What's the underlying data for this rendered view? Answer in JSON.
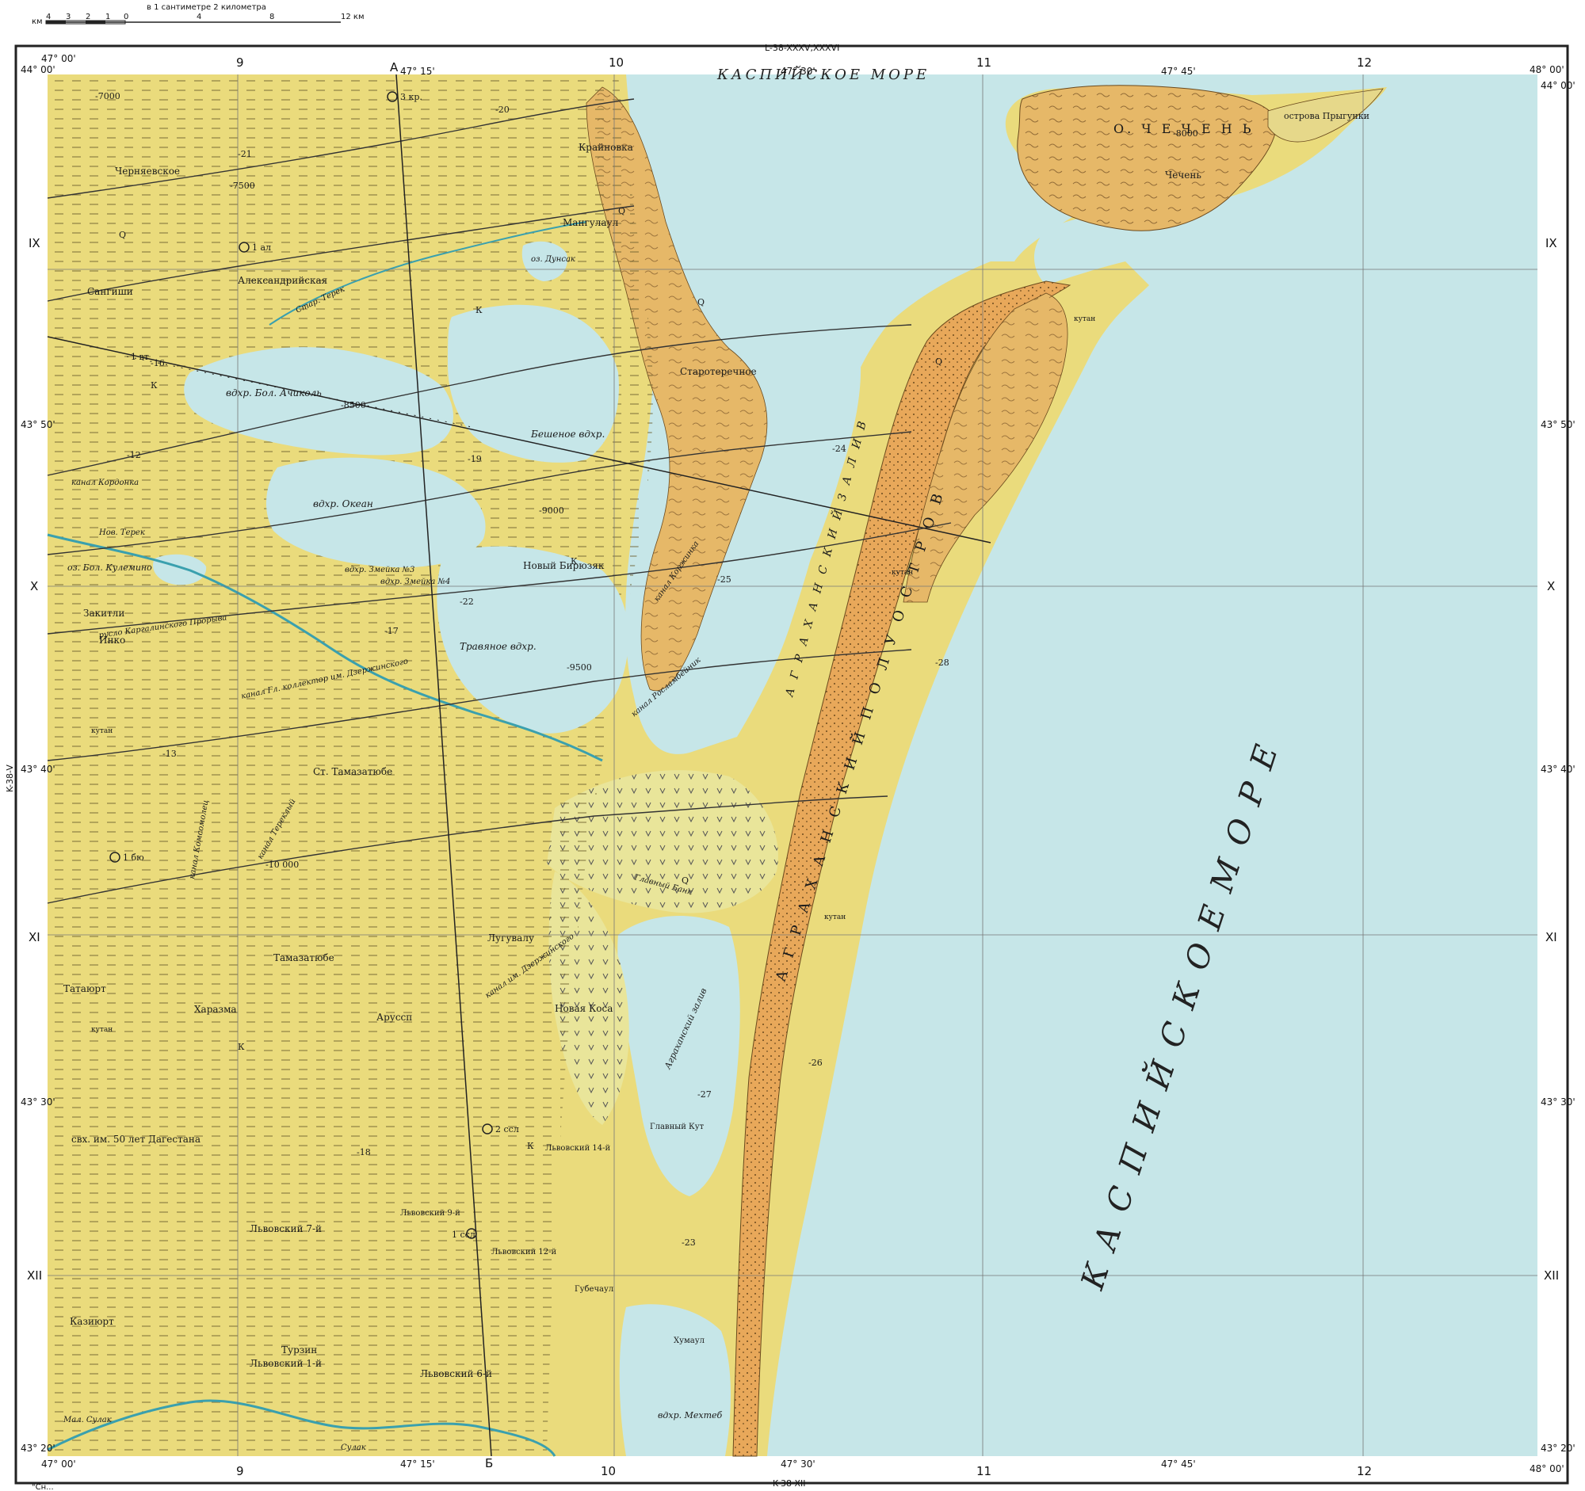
{
  "scale": {
    "caption": "в 1 сантиметре 2 километра",
    "unit_left": "км",
    "unit_right": "12 км",
    "ticks": [
      "4",
      "3",
      "2",
      "1",
      "0",
      "4",
      "8"
    ]
  },
  "sheet": {
    "top_adjacent": "L-38-XXXV,XXXVI",
    "bottom_adjacent": "K-38-XII",
    "left_adjacent": "K-38-V",
    "footnote": "\"Сн..."
  },
  "coordinates": {
    "top_left_lat": "44° 00'",
    "top_left_lon": "47° 00'",
    "top_right_lat": "44° 00'",
    "top_right_lon": "48° 00'",
    "bottom_left_lat": "43° 20'",
    "bottom_left_lon": "47° 00'",
    "bottom_right_lat": "43° 20'",
    "bottom_right_lon": "48° 00'",
    "lon_ticks": [
      "47° 15'",
      "47° 30'",
      "47° 45'"
    ],
    "lat_ticks": [
      "43° 50'",
      "43° 40'",
      "43° 30'"
    ],
    "grid_cols": [
      "9",
      "10",
      "11",
      "12"
    ],
    "grid_rows": [
      "IX",
      "X",
      "XI",
      "XII"
    ],
    "profile_top": "А",
    "profile_bottom": "Б"
  },
  "sea_labels": {
    "top": "КАСПИЙСКОЕ МОРЕ",
    "main": "К А С П И Й С К О Е   М О Р Е"
  },
  "water_labels": [
    "вдхр. Бол. Ачиколь",
    "Бешеное вдхр.",
    "вдхр. Океан",
    "Травяное вдхр.",
    "вдхр. Змейка №3",
    "вдхр. Змейка №4",
    "оз. Дунсак",
    "Аграханский залив",
    "вдхр. Мехтеб",
    "оз. Бол. Кулемино",
    "А Г Р А Х А Н С К И Й   З А Л И В"
  ],
  "peninsula_label": "А Г Р А Х А Н С К И Й   П О Л У О С Т Р О В",
  "island_label": "О. Ч Е Ч Е Н Ь",
  "islands_small": "острова Прыгунки",
  "settlements": [
    "Черняевское",
    "Крайновка",
    "Мангулаул",
    "Александрийская",
    "Сангиши",
    "Старотеречное",
    "Новый Бирюзяк",
    "Закитли",
    "Инко",
    "Ст. Тамазатюбе",
    "Лугувалу",
    "Тамазатюбе",
    "Татаюрт",
    "Харазма",
    "Аруссп",
    "Новая Коса",
    "свх. им. 50 лет Дагестана",
    "Львовский 7-й",
    "Львовский 9-й",
    "Львовский 12-й",
    "Львовский 14-й",
    "Губечаул",
    "Казиюрт",
    "Турзин",
    "Львовский 1-й",
    "Львовский 6-й",
    "Хумаул",
    "Главный Кут",
    "Чечень"
  ],
  "canals": [
    "канал Кордонка",
    "Нов. Терек",
    "канал Коржинка",
    "канал Росламбейник",
    "канал Гл. коллектор им. Дзержинского",
    "канал Тереклый",
    "канал Комсомолец",
    "Главный Банк",
    "канал им. Дзержинского",
    "Стар. Терек",
    "Мал. Сулак",
    "Сулак",
    "русло Каргалинского Прорыва"
  ],
  "symbols": {
    "quaternary": "Q",
    "kutan": "кутан",
    "k": "К"
  },
  "depths": [
    "-20",
    "-21",
    "-16",
    "-19",
    "-12",
    "-22",
    "-17",
    "-13",
    "-25",
    "-24",
    "-18",
    "-23",
    "-27",
    "-28",
    "-26"
  ],
  "isolines": [
    "-7000",
    "-7500",
    "-8000",
    "-8500",
    "-9000",
    "-9500",
    "-10 000"
  ],
  "wells": [
    "3 кр.",
    "1 ал",
    "1 бю",
    "2 ссл",
    "1 ссл",
    "1 вт"
  ],
  "colors": {
    "sea": "#c6e6e8",
    "lowland": "#eadb7c",
    "terrace": "#e6b868",
    "sand": "#e8a85a",
    "marsh": "#e9e59a",
    "line": "#3b3b3b"
  }
}
